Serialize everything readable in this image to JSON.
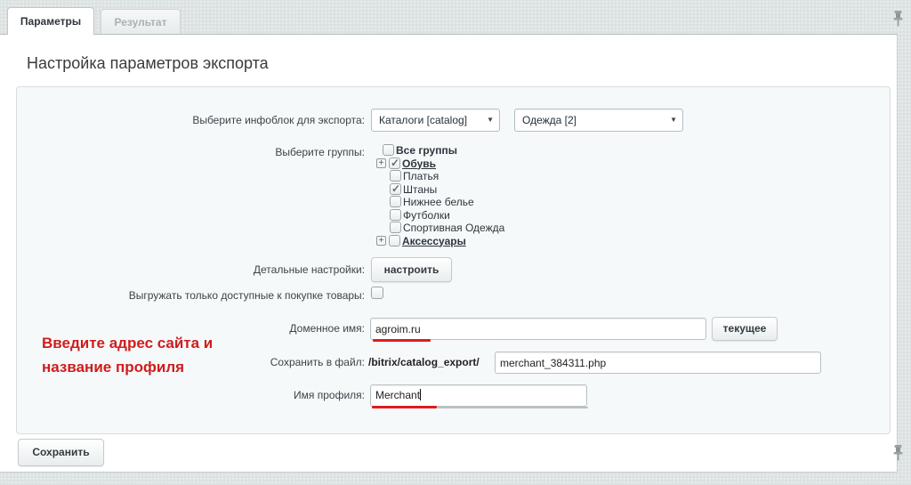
{
  "tabs": {
    "parameters": "Параметры",
    "result": "Результат"
  },
  "title": "Настройка параметров экспорта",
  "form": {
    "infoblock": {
      "label": "Выберите инфоблок для экспорта:",
      "catalog_select": "Каталоги [catalog]",
      "iblock_select": "Одежда [2]"
    },
    "groups": {
      "label": "Выберите группы:",
      "items": [
        {
          "label": "Все группы",
          "checked": false,
          "bold": true,
          "expandable": false
        },
        {
          "label": "Обувь",
          "checked": true,
          "bold": true,
          "expandable": true
        },
        {
          "label": "Платья",
          "checked": false,
          "bold": false,
          "expandable": false
        },
        {
          "label": "Штаны",
          "checked": true,
          "bold": false,
          "expandable": false
        },
        {
          "label": "Нижнее белье",
          "checked": false,
          "bold": false,
          "expandable": false
        },
        {
          "label": "Футболки",
          "checked": false,
          "bold": false,
          "expandable": false
        },
        {
          "label": "Спортивная Одежда",
          "checked": false,
          "bold": false,
          "expandable": false
        },
        {
          "label": "Аксессуары",
          "checked": false,
          "bold": true,
          "expandable": true
        }
      ]
    },
    "details": {
      "label": "Детальные настройки:",
      "button": "настроить"
    },
    "available_only": {
      "label": "Выгружать только доступные к покупке товары:",
      "checked": false
    },
    "domain": {
      "label": "Доменное имя:",
      "value": "agroim.ru",
      "button": "текущее"
    },
    "file": {
      "label": "Сохранить в файл:",
      "prefix": "/bitrix/catalog_export/",
      "value": "merchant_384311.php"
    },
    "profile": {
      "label": "Имя профиля:",
      "value": "Merchant"
    }
  },
  "annotation": {
    "line1": "Введите адрес сайта и",
    "line2": "название профиля"
  },
  "actions": {
    "save": "Сохранить"
  },
  "colors": {
    "annotation_red": "#cf1d1d",
    "underline_red": "#dd1d1d",
    "panel_bg": "#f6f9fa"
  }
}
